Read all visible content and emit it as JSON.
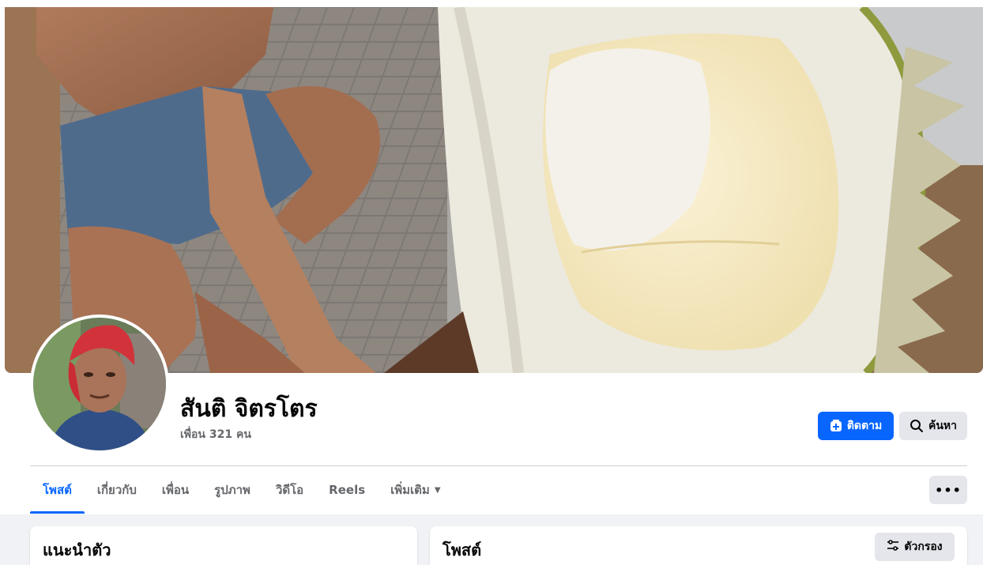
{
  "profile": {
    "name": "สันติ จิตรโตร",
    "friends_text": "เพื่อน 321 คน",
    "cover_image": "durian-cover-photo",
    "avatar_image": "profile-picture-red-bandana"
  },
  "actions": {
    "follow_label": "ติดตาม",
    "follow_icon": "follow-plus-icon",
    "search_label": "ค้นหา",
    "search_icon": "search-icon",
    "more_label": "•••"
  },
  "tabs": [
    {
      "label": "โพสต์",
      "active": true
    },
    {
      "label": "เกี่ยวกับ",
      "active": false
    },
    {
      "label": "เพื่อน",
      "active": false
    },
    {
      "label": "รูปภาพ",
      "active": false
    },
    {
      "label": "วิดีโอ",
      "active": false
    },
    {
      "label": "Reels",
      "active": false
    },
    {
      "label": "เพิ่มเติม",
      "active": false,
      "dropdown": true
    }
  ],
  "intro": {
    "title": "แนะนำตัว"
  },
  "posts": {
    "title": "โพสต์",
    "filter_label": "ตัวกรอง",
    "filter_icon": "filter-sliders-icon"
  },
  "colors": {
    "accent": "#0866ff",
    "secondary_button": "#e4e6eb",
    "page_background": "#f0f2f5",
    "muted_text": "#65676b"
  }
}
